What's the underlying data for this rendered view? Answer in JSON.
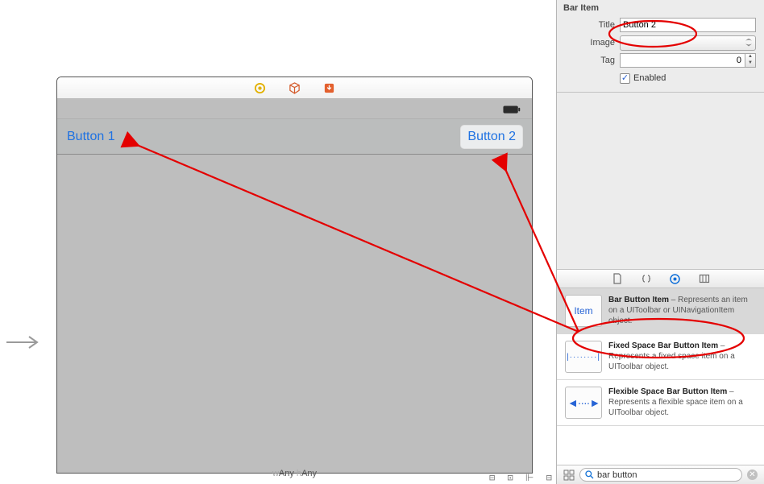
{
  "inspector": {
    "section": "Bar Item",
    "title_label": "Title",
    "title_value": "Button 2",
    "image_label": "Image",
    "tag_label": "Tag",
    "tag_value": "0",
    "enabled_label": "Enabled"
  },
  "canvas": {
    "button1": "Button 1",
    "button2": "Button 2",
    "size_class_w": "w",
    "size_class_wval": "Any",
    "size_class_h": " h",
    "size_class_hval": "Any"
  },
  "library": {
    "items": [
      {
        "thumb": "Item",
        "name": "Bar Button Item",
        "desc": " – Represents an item on a UIToolbar or UINavigationItem object."
      },
      {
        "thumb": "dots",
        "name": "Fixed Space Bar Button Item",
        "desc": " – Represents a fixed space item on a UIToolbar object."
      },
      {
        "thumb": "flex",
        "name": "Flexible Space Bar Button Item",
        "desc": " – Represents a flexible space item on a UIToolbar object."
      }
    ],
    "search_text": "bar button"
  }
}
